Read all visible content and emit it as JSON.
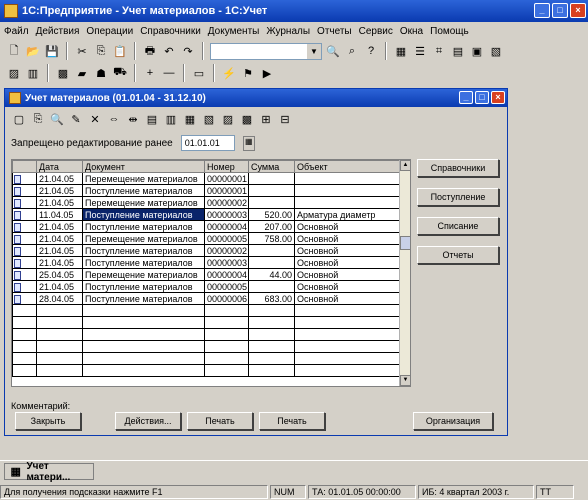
{
  "window": {
    "title": "1С:Предприятие - Учет материалов - 1С:Учет"
  },
  "menu": [
    "Файл",
    "Действия",
    "Операции",
    "Справочники",
    "Документы",
    "Журналы",
    "Отчеты",
    "Сервис",
    "Окна",
    "Помощь"
  ],
  "mdi": {
    "title": "Учет материалов (01.01.04 - 31.12.10)",
    "date_label": "Запрещено редактирование ранее",
    "date_value": "01.01.01"
  },
  "grid": {
    "columns": [
      "",
      "Дата",
      "Документ",
      "Номер",
      "Сумма",
      "Объект"
    ],
    "rows": [
      {
        "date": "21.04.05",
        "doc": "Перемещение материалов",
        "num": "00000001",
        "sum": "",
        "obj": ""
      },
      {
        "date": "21.04.05",
        "doc": "Поступление материалов",
        "num": "00000001",
        "sum": "",
        "obj": ""
      },
      {
        "date": "21.04.05",
        "doc": "Перемещение материалов",
        "num": "00000002",
        "sum": "",
        "obj": ""
      },
      {
        "date": "11.04.05",
        "doc": "Поступление материалов",
        "num": "00000003",
        "sum": "520.00",
        "obj": "Арматура диаметр"
      },
      {
        "date": "21.04.05",
        "doc": "Поступление материалов",
        "num": "00000004",
        "sum": "207.00",
        "obj": "Основной"
      },
      {
        "date": "21.04.05",
        "doc": "Перемещение материалов",
        "num": "00000005",
        "sum": "758.00",
        "obj": "Основной"
      },
      {
        "date": "21.04.05",
        "doc": "Поступление материалов",
        "num": "00000002",
        "sum": "",
        "obj": "Основной"
      },
      {
        "date": "21.04.05",
        "doc": "Поступление материалов",
        "num": "00000003",
        "sum": "",
        "obj": "Основной"
      },
      {
        "date": "25.04.05",
        "doc": "Перемещение материалов",
        "num": "00000004",
        "sum": "44.00",
        "obj": "Основной"
      },
      {
        "date": "21.04.05",
        "doc": "Поступление материалов",
        "num": "00000005",
        "sum": "",
        "obj": "Основной"
      },
      {
        "date": "28.04.05",
        "doc": "Поступление материалов",
        "num": "00000006",
        "sum": "683.00",
        "obj": "Основной"
      }
    ]
  },
  "side_buttons": [
    "Справочники",
    "Поступление",
    "Списание",
    "Отчеты"
  ],
  "comment_label": "Комментарий:",
  "bottom_buttons": [
    "Закрыть",
    "Действия...",
    "Печать",
    "Печать",
    "Организация"
  ],
  "taskbar": {
    "item": "Учет матери..."
  },
  "status": {
    "hint": "Для получения подсказки нажмите F1",
    "cap": "NUM",
    "date": "ТА: 01.01.05 00:00:00",
    "period": "ИБ: 4 квартал 2003 г.",
    "mode": "TT"
  }
}
